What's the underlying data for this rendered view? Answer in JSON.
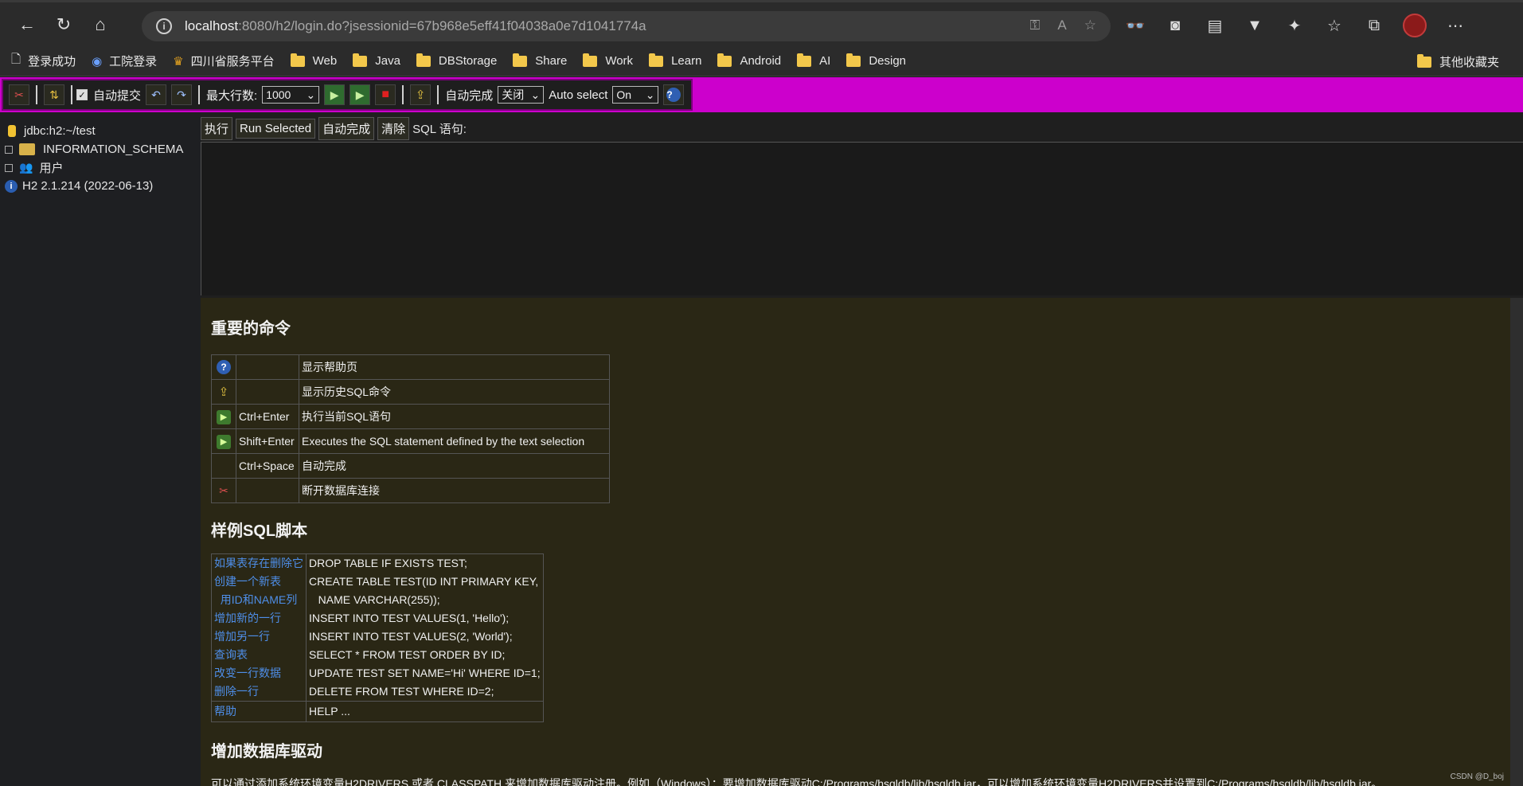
{
  "browser": {
    "url_host": "localhost",
    "url_rest": ":8080/h2/login.do?jsessionid=67b968e5eff41f04038a0e7d1041774a"
  },
  "bookmarks": {
    "items": [
      "登录成功",
      "工院登录",
      "四川省服务平台",
      "Web",
      "Java",
      "DBStorage",
      "Share",
      "Work",
      "Learn",
      "Android",
      "AI",
      "Design"
    ],
    "other": "其他收藏夹"
  },
  "toolbar": {
    "autocommit_label": "自动提交",
    "maxrows_label": "最大行数:",
    "maxrows_value": "1000",
    "autocomplete_label": "自动完成",
    "autocomplete_value": "关闭",
    "autoselect_label": "Auto select",
    "autoselect_value": "On"
  },
  "tree": {
    "connection": "jdbc:h2:~/test",
    "schema": "INFORMATION_SCHEMA",
    "users": "用户",
    "version": "H2 2.1.214 (2022-06-13)"
  },
  "sql": {
    "execute": "执行",
    "run_selected": "Run Selected",
    "autocomplete": "自动完成",
    "clear": "清除",
    "label": "SQL 语句:"
  },
  "help": {
    "important_title": "重要的命令",
    "commands": [
      {
        "key": "",
        "desc": "显示帮助页"
      },
      {
        "key": "",
        "desc": "显示历史SQL命令"
      },
      {
        "key": "Ctrl+Enter",
        "desc": "执行当前SQL语句"
      },
      {
        "key": "Shift+Enter",
        "desc": "Executes the SQL statement defined by the text selection"
      },
      {
        "key": "Ctrl+Space",
        "desc": "自动完成"
      },
      {
        "key": "",
        "desc": "断开数据库连接"
      }
    ],
    "sample_title": "样例SQL脚本",
    "samples": [
      {
        "label": "如果表存在删除它",
        "sql": "DROP TABLE IF EXISTS TEST;"
      },
      {
        "label": "创建一个新表",
        "sql": "CREATE TABLE TEST(ID INT PRIMARY KEY,"
      },
      {
        "label": "  用ID和NAME列",
        "sql": "   NAME VARCHAR(255));"
      },
      {
        "label": "增加新的一行",
        "sql": "INSERT INTO TEST VALUES(1, 'Hello');"
      },
      {
        "label": "增加另一行",
        "sql": "INSERT INTO TEST VALUES(2, 'World');"
      },
      {
        "label": "查询表",
        "sql": "SELECT * FROM TEST ORDER BY ID;"
      },
      {
        "label": "改变一行数据",
        "sql": "UPDATE TEST SET NAME='Hi' WHERE ID=1;"
      },
      {
        "label": "删除一行",
        "sql": "DELETE FROM TEST WHERE ID=2;"
      }
    ],
    "help_label": "帮助",
    "help_sql": "HELP ...",
    "driver_title": "增加数据库驱动",
    "driver_text": "可以通过添加系统环境变量H2DRIVERS 或者 CLASSPATH 来增加数据库驱动注册。例如（Windows）：要增加数据库驱动C:/Programs/hsqldb/lib/hsqldb.jar，可以增加系统环境变量H2DRIVERS并设置到C:/Programs/hsqldb/lib/hsqldb.jar。",
    "watermark": "CSDN @D_boj"
  },
  "colors": {
    "toolbar_bg": "#cc00cc",
    "help_bg": "#2a2715",
    "link": "#4e8ee8"
  }
}
